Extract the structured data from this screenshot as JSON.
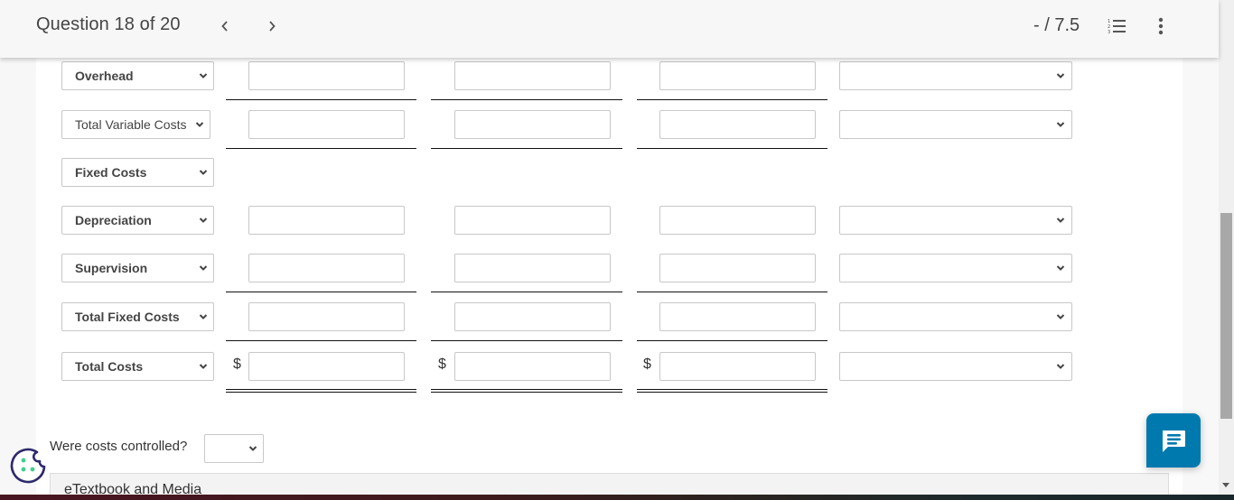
{
  "header": {
    "question_label": "Question 18 of 20",
    "prev_icon": "chevron-left-icon",
    "next_icon": "chevron-right-icon",
    "score": "- / 7.5",
    "list_icon": "numbered-list-icon",
    "more_icon": "more-vertical-icon"
  },
  "rows": [
    {
      "label": "Overhead",
      "bold": true,
      "inputs": [
        "",
        "",
        ""
      ],
      "dollar": false,
      "unit": "",
      "rule": "single"
    },
    {
      "label": "Total Variable Costs",
      "bold": false,
      "inputs": [
        "",
        "",
        ""
      ],
      "dollar": false,
      "unit": "",
      "rule": "single"
    },
    {
      "label": "Fixed Costs",
      "bold": true,
      "inputs": null,
      "dollar": false,
      "unit": null,
      "rule": "none"
    },
    {
      "label": "Depreciation",
      "bold": true,
      "inputs": [
        "",
        "",
        ""
      ],
      "dollar": false,
      "unit": "",
      "rule": "none"
    },
    {
      "label": "Supervision",
      "bold": true,
      "inputs": [
        "",
        "",
        ""
      ],
      "dollar": false,
      "unit": "",
      "rule": "single"
    },
    {
      "label": "Total Fixed Costs",
      "bold": true,
      "inputs": [
        "",
        "",
        ""
      ],
      "dollar": false,
      "unit": "",
      "rule": "single"
    },
    {
      "label": "Total Costs",
      "bold": true,
      "inputs": [
        "",
        "",
        ""
      ],
      "dollar": true,
      "unit": "",
      "rule": "double"
    }
  ],
  "currency_symbol": "$",
  "controlled": {
    "label": "Were costs controlled?",
    "value": ""
  },
  "etextbook": {
    "label": "eTextbook and Media"
  },
  "cookie_icon": "cookie-settings-icon",
  "chat_icon": "chat-message-icon",
  "colors": {
    "chat_accent": "#0079ae",
    "cookie_outline": "#2e2a6b",
    "cookie_dots": "#3ecf8e"
  }
}
